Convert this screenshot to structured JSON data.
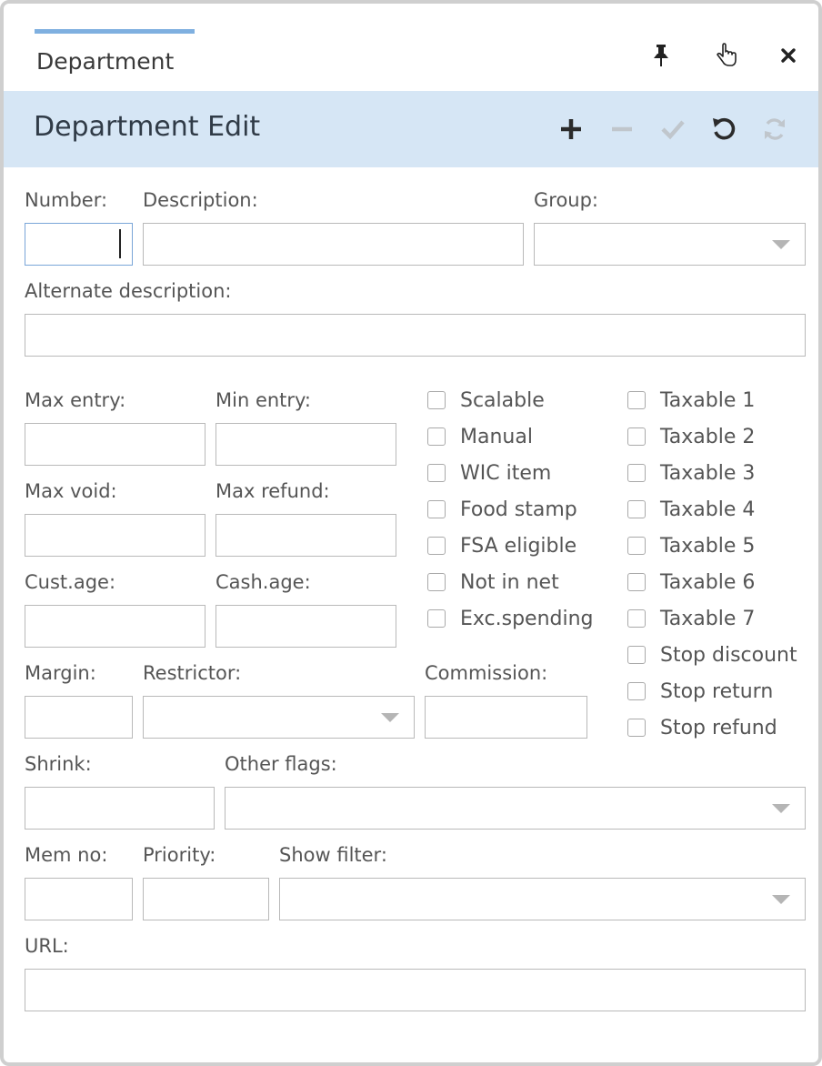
{
  "tab": {
    "label": "Department"
  },
  "window_icons": [
    {
      "name": "pin-icon"
    },
    {
      "name": "pointer-icon"
    },
    {
      "name": "close-icon"
    }
  ],
  "toolbar": {
    "title": "Department Edit",
    "actions": [
      {
        "name": "add-icon",
        "enabled": true
      },
      {
        "name": "remove-icon",
        "enabled": false
      },
      {
        "name": "confirm-icon",
        "enabled": false
      },
      {
        "name": "undo-icon",
        "enabled": true
      },
      {
        "name": "refresh-icon",
        "enabled": false
      }
    ]
  },
  "form": {
    "number": {
      "label": "Number:",
      "value": ""
    },
    "description": {
      "label": "Description:",
      "value": ""
    },
    "group": {
      "label": "Group:",
      "value": ""
    },
    "alternate_description": {
      "label": "Alternate description:",
      "value": ""
    },
    "max_entry": {
      "label": "Max entry:",
      "value": ""
    },
    "min_entry": {
      "label": "Min entry:",
      "value": ""
    },
    "max_void": {
      "label": "Max void:",
      "value": ""
    },
    "max_refund": {
      "label": "Max refund:",
      "value": ""
    },
    "cust_age": {
      "label": "Cust.age:",
      "value": ""
    },
    "cash_age": {
      "label": "Cash.age:",
      "value": ""
    },
    "margin": {
      "label": "Margin:",
      "value": ""
    },
    "restrictor": {
      "label": "Restrictor:",
      "value": ""
    },
    "commission": {
      "label": "Commission:",
      "value": ""
    },
    "shrink": {
      "label": "Shrink:",
      "value": ""
    },
    "other_flags": {
      "label": "Other flags:",
      "value": ""
    },
    "mem_no": {
      "label": "Mem no:",
      "value": ""
    },
    "priority": {
      "label": "Priority:",
      "value": ""
    },
    "show_filter": {
      "label": "Show filter:",
      "value": ""
    },
    "url": {
      "label": "URL:",
      "value": ""
    }
  },
  "flags_left": [
    {
      "label": "Scalable",
      "checked": false
    },
    {
      "label": "Manual",
      "checked": false
    },
    {
      "label": "WIC item",
      "checked": false
    },
    {
      "label": "Food stamp",
      "checked": false
    },
    {
      "label": "FSA eligible",
      "checked": false
    },
    {
      "label": "Not in net",
      "checked": false
    },
    {
      "label": "Exc.spending",
      "checked": false
    }
  ],
  "flags_right": [
    {
      "label": "Taxable 1",
      "checked": false
    },
    {
      "label": "Taxable 2",
      "checked": false
    },
    {
      "label": "Taxable 3",
      "checked": false
    },
    {
      "label": "Taxable 4",
      "checked": false
    },
    {
      "label": "Taxable 5",
      "checked": false
    },
    {
      "label": "Taxable 6",
      "checked": false
    },
    {
      "label": "Taxable 7",
      "checked": false
    },
    {
      "label": "Stop discount",
      "checked": false
    },
    {
      "label": "Stop return",
      "checked": false
    },
    {
      "label": "Stop refund",
      "checked": false
    }
  ],
  "colors": {
    "toolbar_bg": "#d6e6f5",
    "tab_accent": "#7fb0e0",
    "icon_active": "#2b2b2b",
    "icon_disabled": "#c0c6cc"
  }
}
